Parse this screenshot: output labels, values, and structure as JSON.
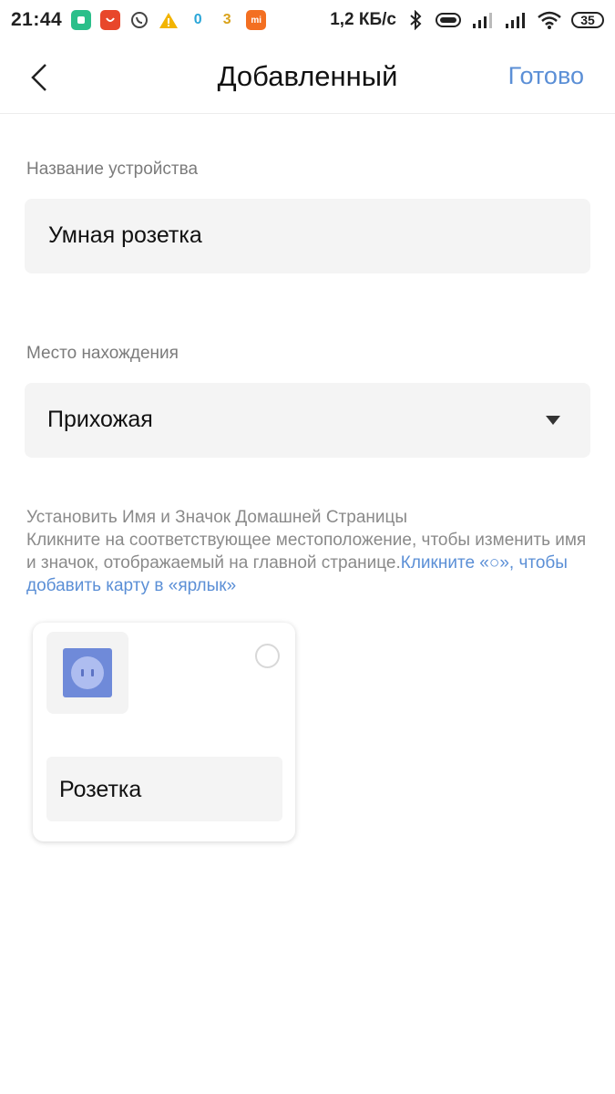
{
  "status_bar": {
    "time": "21:44",
    "speed": "1,2 КБ/с",
    "battery": "35",
    "icons": [
      "mi-home-icon",
      "aliexpress-icon",
      "whatsapp-icon",
      "warning-icon",
      "mi-fit-icon",
      "3-icon",
      "mi-store-icon",
      "bluetooth-icon",
      "vibrate-icon",
      "signal-icon",
      "signal-icon",
      "wifi-icon"
    ]
  },
  "header": {
    "title": "Добавленный",
    "done_label": "Готово"
  },
  "form": {
    "name_label": "Название устройства",
    "name_value": "Умная розетка",
    "location_label": "Место нахождения",
    "location_value": "Прихожая"
  },
  "hint": {
    "line1": "Установить Имя и Значок Домашней Страницы",
    "line2": "Кликните на соответствующее местоположение, чтобы изменить имя и значок, отображаемый на главной странице.",
    "link": "Кликните «○», чтобы добавить карту в «ярлык»"
  },
  "card": {
    "name": "Розетка",
    "icon": "smart-plug-icon"
  },
  "colors": {
    "accent": "#5b8fd6",
    "field_bg": "#f4f4f4",
    "plug_blue": "#6f8ad9"
  }
}
